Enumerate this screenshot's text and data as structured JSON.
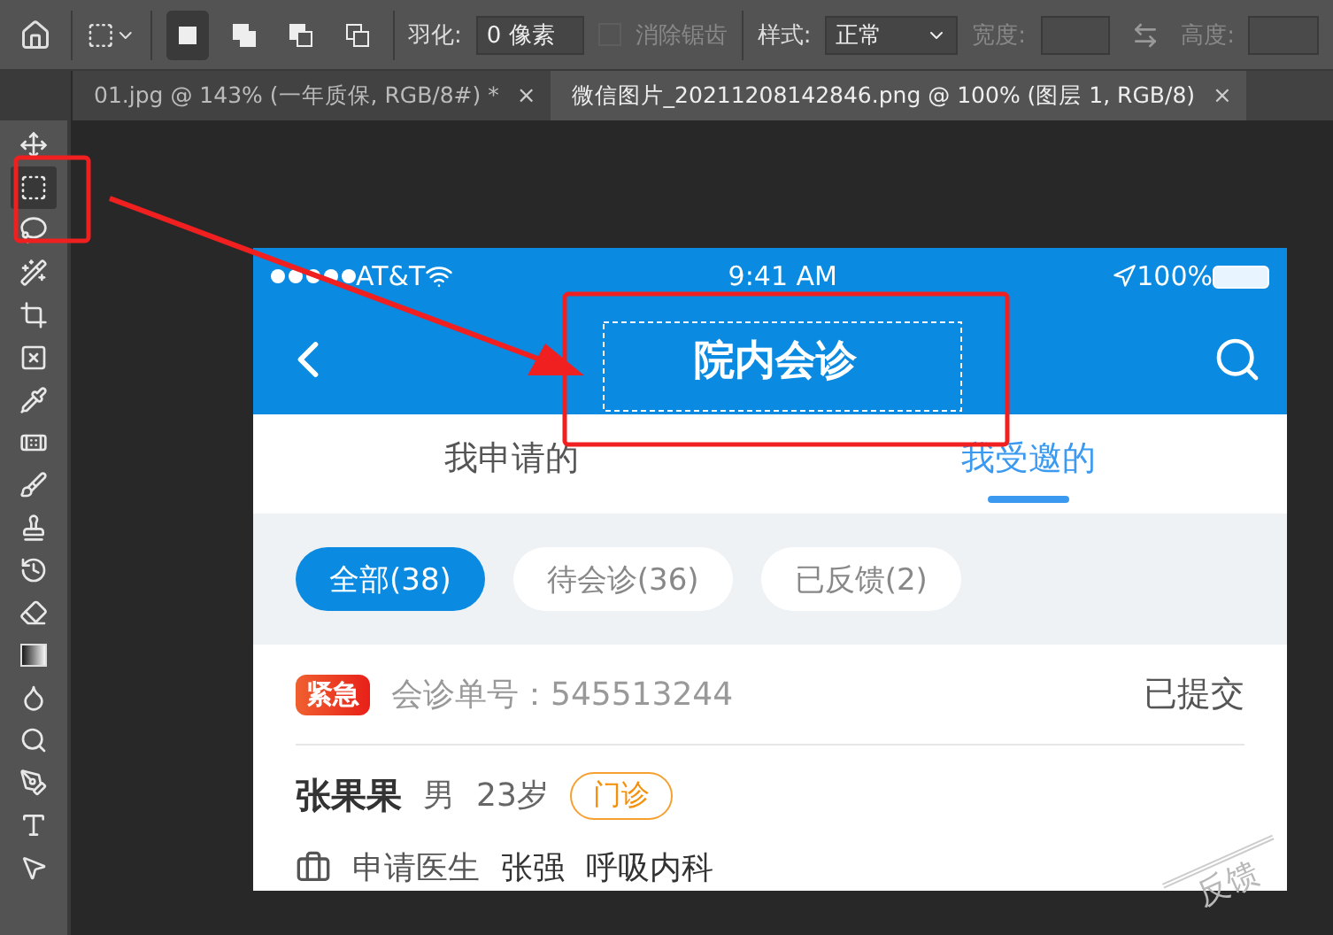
{
  "options_bar": {
    "feather_label": "羽化:",
    "feather_value": "0 像素",
    "antialias": {
      "label": "消除锯齿",
      "checked": false,
      "disabled": true
    },
    "style_label": "样式:",
    "style_value": "正常",
    "width_label": "宽度:",
    "height_label": "高度:",
    "modes": [
      {
        "selected": true
      },
      {
        "selected": false
      },
      {
        "selected": false
      },
      {
        "selected": false
      }
    ]
  },
  "document_tabs": [
    {
      "title": "01.jpg @ 143% (一年质保, RGB/8#) *",
      "selected": false,
      "close": "×"
    },
    {
      "title": "微信图片_20211208142846.png @ 100% (图层 1, RGB/8)",
      "selected": true,
      "close": "×"
    }
  ],
  "tools": [
    {
      "selected": false
    },
    {
      "selected": true
    },
    {
      "selected": false
    },
    {
      "selected": false
    },
    {
      "selected": false
    },
    {
      "selected": false
    },
    {
      "selected": false
    },
    {
      "selected": false
    },
    {
      "selected": false
    },
    {
      "selected": false
    },
    {
      "selected": false
    },
    {
      "selected": false
    },
    {
      "selected": false
    },
    {
      "selected": false
    },
    {
      "selected": false
    },
    {
      "selected": false
    },
    {
      "selected": false
    },
    {
      "selected": false
    }
  ],
  "phone": {
    "status_bar": {
      "carrier": "AT&T",
      "time": "9:41 AM",
      "battery": "100%"
    },
    "nav_title": "院内会诊",
    "tabs": [
      {
        "label": "我申请的",
        "selected": false
      },
      {
        "label": "我受邀的",
        "selected": true
      }
    ],
    "filters": [
      {
        "label": "全部(38)",
        "selected": true
      },
      {
        "label": "待会诊(36)",
        "selected": false
      },
      {
        "label": "已反馈(2)",
        "selected": false
      }
    ],
    "card": {
      "badge": "紧急",
      "number": "会诊单号：545513244",
      "status": "已提交",
      "patient": "张果果",
      "gender": "男",
      "age": "23岁",
      "tag": "门诊",
      "doctor_label": "申请医生",
      "doctor": "张强",
      "department": "呼吸内科",
      "stamp": "反馈"
    }
  }
}
